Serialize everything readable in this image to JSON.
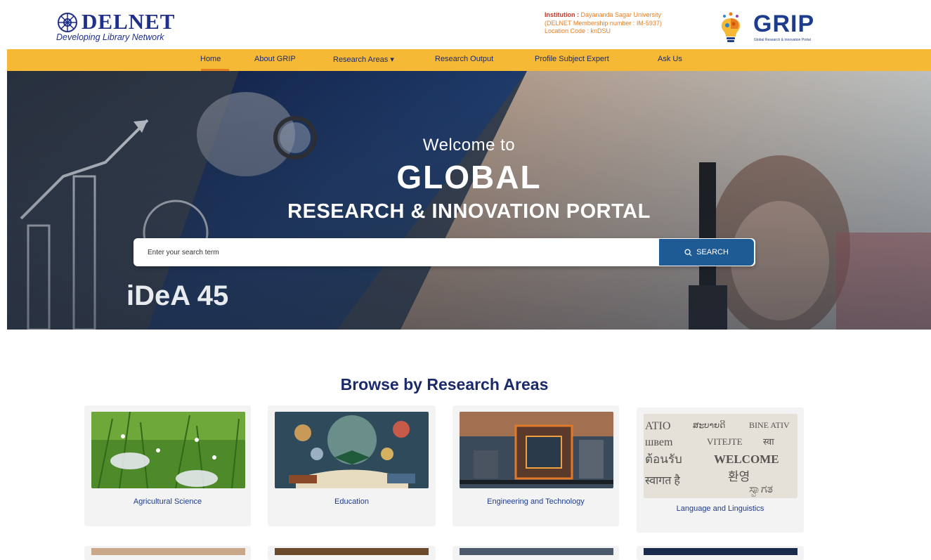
{
  "header": {
    "logo_title": "DELNET",
    "logo_tagline": "Developing Library Network",
    "institution_label": "Institution : ",
    "institution_value": "Dayananda Sagar University",
    "membership_line": "(DELNET Membership number : IM-5937)",
    "location_line": "Location Code : knDSU",
    "grip_title": "GRIP",
    "grip_subtitle": "Global Research & Innovation Portal"
  },
  "nav": {
    "items": [
      {
        "label": "Home"
      },
      {
        "label": "About GRIP"
      },
      {
        "label": "Research Areas ▾"
      },
      {
        "label": "Research Output"
      },
      {
        "label": "Profile Subject Expert"
      },
      {
        "label": "Ask Us"
      }
    ],
    "active_index": 0
  },
  "hero": {
    "welcome": "Welcome to",
    "global": "GLOBAL",
    "portal": "RESEARCH & INNOVATION PORTAL",
    "board_text": "iDeA 45",
    "search_placeholder": "Enter your search term",
    "search_button": "SEARCH"
  },
  "browse": {
    "title": "Browse by Research Areas",
    "cards": [
      {
        "label": "Agricultural Science"
      },
      {
        "label": "Education"
      },
      {
        "label": "Engineering and Technology"
      },
      {
        "label": "Language and Linguistics"
      }
    ]
  },
  "colors": {
    "nav_bg": "#f5b935",
    "brand_blue": "#1b2a6b",
    "search_button": "#1e5b94",
    "accent_orange": "#e67e22"
  }
}
